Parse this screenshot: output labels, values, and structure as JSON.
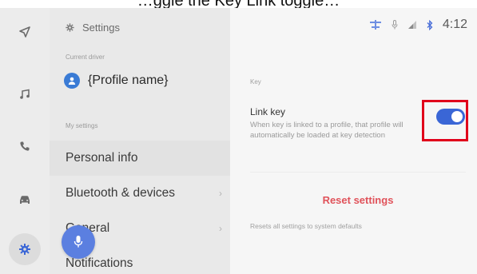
{
  "caption": "…ggle the Key Link toggle…",
  "colors": {
    "accent_blue": "#3a66d6",
    "reset_red": "#e0525a",
    "highlight_red": "#e0001b",
    "mic_blue": "#5b7fe0"
  },
  "rail": {
    "items": [
      {
        "icon": "navigation-icon"
      },
      {
        "icon": "music-icon"
      },
      {
        "icon": "phone-icon"
      },
      {
        "icon": "car-icon"
      },
      {
        "icon": "settings-gear-icon",
        "active": true
      }
    ]
  },
  "settings_list": {
    "header": "Settings",
    "current_driver_label": "Current driver",
    "profile_name": "{Profile name}",
    "my_settings_label": "My settings",
    "items": [
      {
        "label": "Personal info",
        "selected": true,
        "chevron": false
      },
      {
        "label": "Bluetooth & devices",
        "chevron": true
      },
      {
        "label": "General",
        "chevron": true
      },
      {
        "label": "Notifications",
        "chevron": false
      }
    ]
  },
  "status_bar": {
    "icons": [
      "steering-sync-icon",
      "mic-muted-icon",
      "signal-icon",
      "bluetooth-icon"
    ],
    "time": "4:12"
  },
  "main": {
    "section_label": "Key",
    "link_key": {
      "title": "Link key",
      "description": "When key is linked to a profile, that profile will automatically be loaded at key detection",
      "toggle_on": true
    },
    "reset": {
      "button_label": "Reset settings",
      "description": "Resets all settings to system defaults"
    }
  }
}
